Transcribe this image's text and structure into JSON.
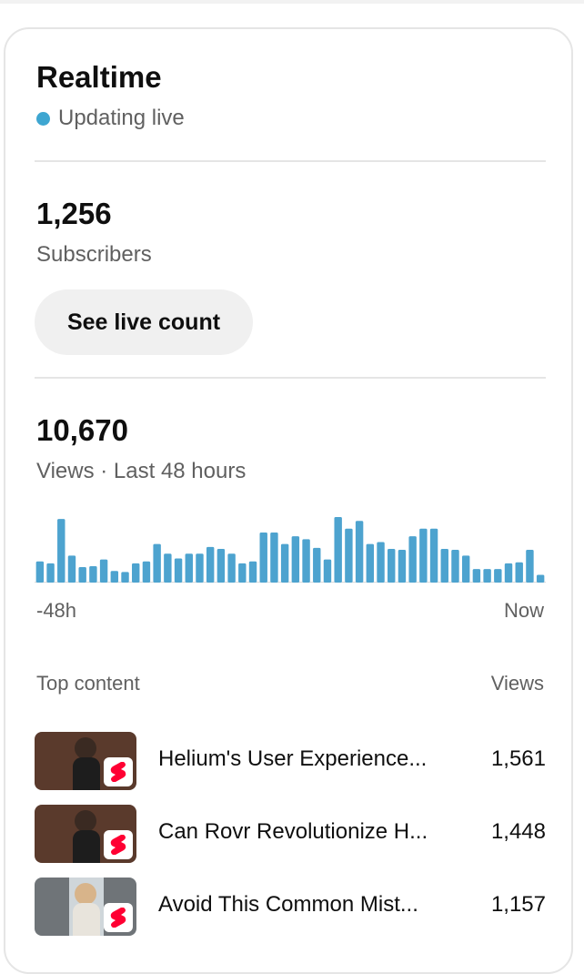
{
  "header": {
    "title": "Realtime",
    "status": "Updating live",
    "status_color": "#3ea6d1"
  },
  "subscribers": {
    "count": "1,256",
    "label": "Subscribers",
    "button_label": "See live count"
  },
  "views": {
    "count": "10,670",
    "label": "Views · Last 48 hours"
  },
  "chart_data": {
    "type": "bar",
    "color": "#4da3cf",
    "x_start_label": "-48h",
    "x_end_label": "Now",
    "values": [
      22,
      20,
      66,
      28,
      16,
      17,
      24,
      12,
      11,
      20,
      22,
      40,
      30,
      25,
      30,
      30,
      37,
      35,
      30,
      20,
      22,
      52,
      52,
      40,
      48,
      45,
      36,
      24,
      68,
      56,
      64,
      40,
      42,
      35,
      34,
      48,
      56,
      56,
      35,
      34,
      28,
      14,
      14,
      14,
      20,
      21,
      34,
      8
    ]
  },
  "top_content": {
    "heading": "Top content",
    "views_heading": "Views",
    "items": [
      {
        "title": "Helium's User Experience...",
        "views": "1,561",
        "thumb_color": "#5a3a2c",
        "icon": "shorts-icon"
      },
      {
        "title": "Can Rovr Revolutionize H...",
        "views": "1,448",
        "thumb_color": "#5a3a2c",
        "icon": "shorts-icon"
      },
      {
        "title": "Avoid This Common Mist...",
        "views": "1,157",
        "thumb_color": "#6f7478",
        "icon": "shorts-icon"
      }
    ]
  },
  "colors": {
    "shorts_red": "#ff0033"
  }
}
